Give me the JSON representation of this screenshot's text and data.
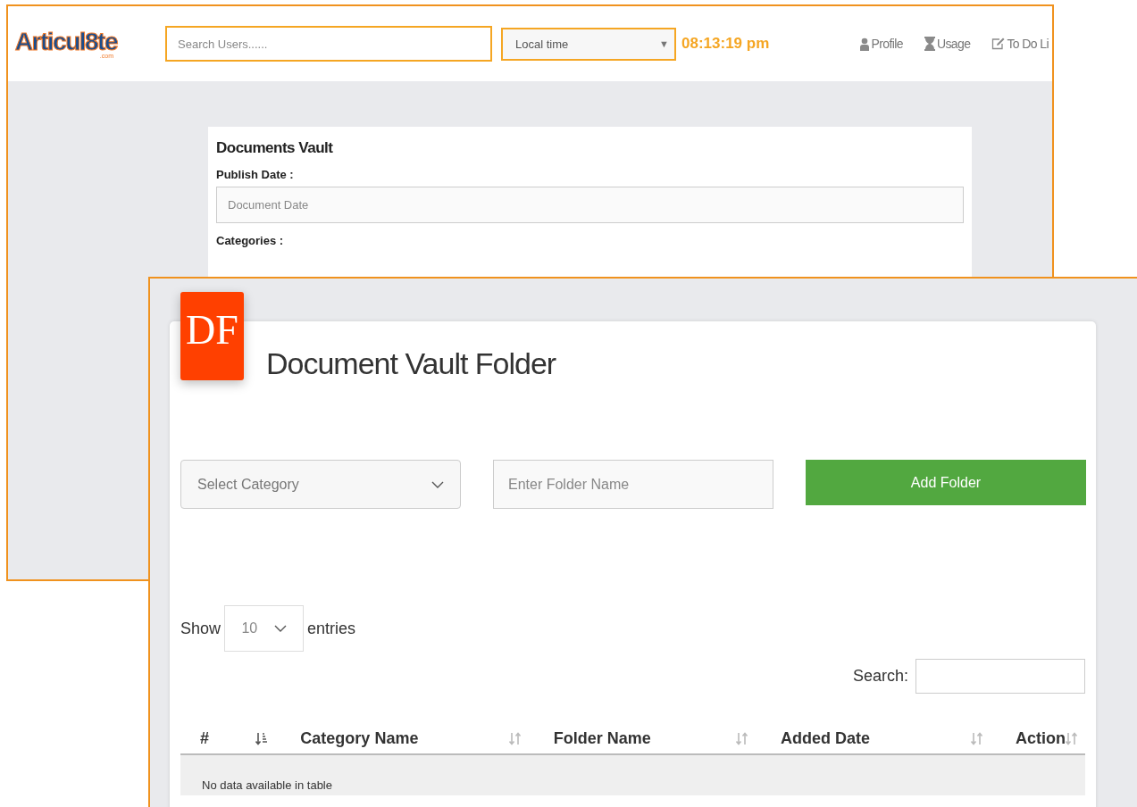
{
  "back_window": {
    "logo": {
      "text": "Articul8te",
      "suffix": ".com"
    },
    "search": {
      "placeholder": "Search Users......"
    },
    "timezone_select": {
      "value": "Local time",
      "caret": "▼"
    },
    "clock": "08:13:19 pm",
    "nav": [
      {
        "label": "Profile",
        "kind": "person"
      },
      {
        "label": "Usage",
        "kind": "hourglass"
      },
      {
        "label": "To Do Li",
        "kind": "edit"
      }
    ],
    "form": {
      "title": "Documents Vault",
      "fields": [
        {
          "label": "Publish Date :",
          "placeholder": "Document Date"
        },
        {
          "label": "Categories :"
        }
      ]
    }
  },
  "front_window": {
    "badge": "DF",
    "title": "Document Vault Folder",
    "category_select": {
      "placeholder": "Select Category"
    },
    "folder_input": {
      "placeholder": "Enter Folder Name"
    },
    "add_button": "Add Folder",
    "length": {
      "before": "Show",
      "value": "10",
      "after": "entries"
    },
    "search_label": "Search:",
    "table": {
      "columns": [
        {
          "label": "#",
          "sorted": true
        },
        {
          "label": "Category Name",
          "sorted": false
        },
        {
          "label": "Folder Name",
          "sorted": false
        },
        {
          "label": "Added Date",
          "sorted": false
        },
        {
          "label": "Action",
          "sorted": false
        }
      ],
      "empty_text": "No data available in table"
    }
  }
}
